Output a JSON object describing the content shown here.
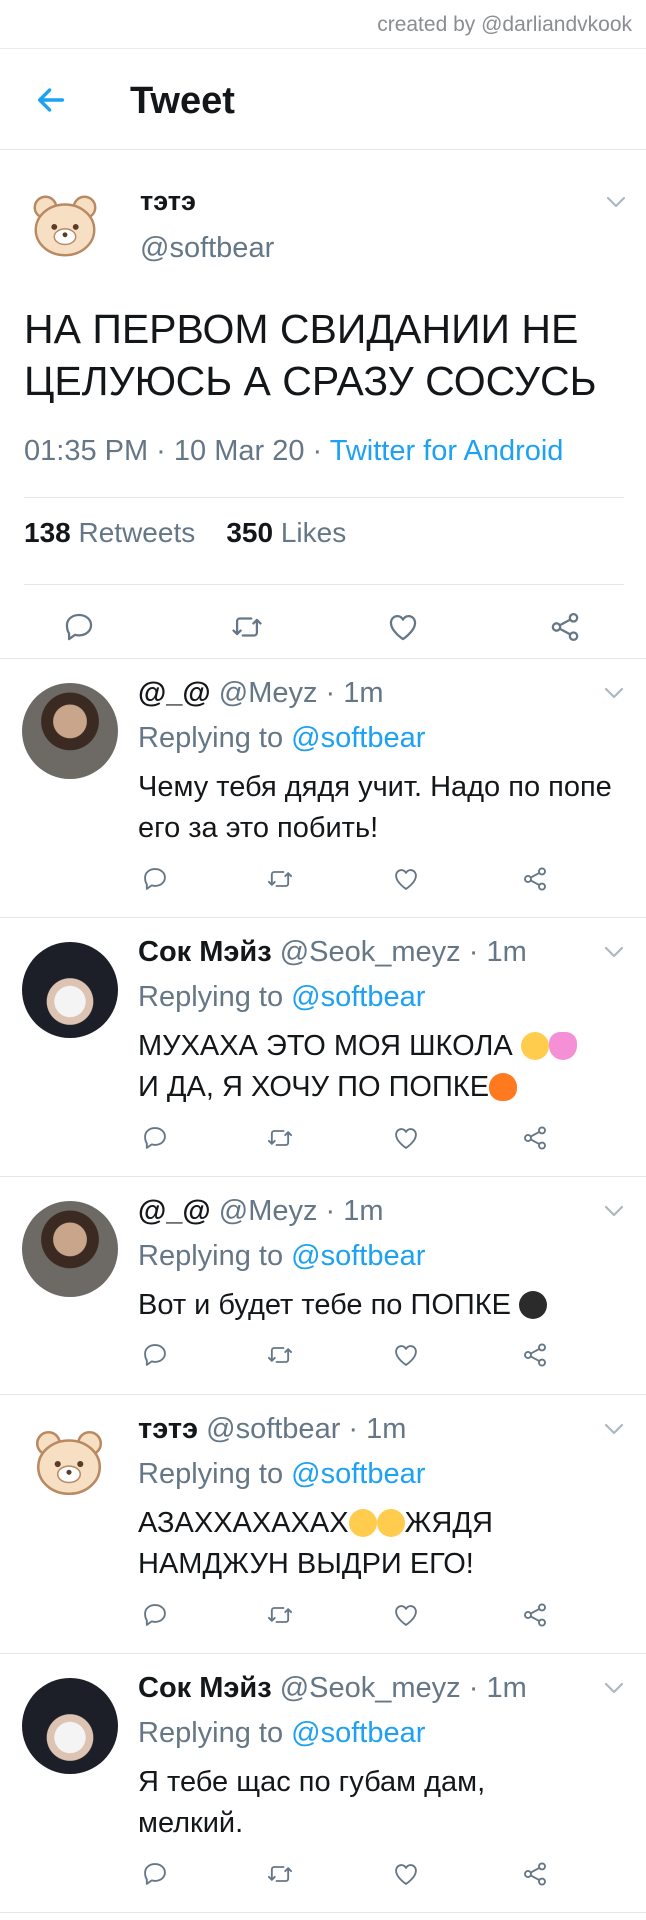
{
  "credit": "created by @darliandvkook",
  "header": {
    "title": "Tweet"
  },
  "main": {
    "name": "тэтэ",
    "handle": "@softbear",
    "text": "НА ПЕРВОМ СВИДАНИИ НЕ ЦЕЛУЮСЬ А СРАЗУ СОСУСЬ",
    "time": "01:35 PM · 10 Mar 20 · ",
    "source": "Twitter for Android",
    "retweets_count": "138",
    "retweets_label": "Retweets",
    "likes_count": "350",
    "likes_label": "Likes"
  },
  "replies": [
    {
      "name": "@_@",
      "handle": "@Meyz · 1m",
      "replying": "Replying to ",
      "to": "@softbear",
      "text": "Чему тебя дядя учит. Надо по попе его за это побить!"
    },
    {
      "name": "Сок Мэйз",
      "handle": "@Seok_meyz · 1m",
      "replying": "Replying to ",
      "to": "@softbear",
      "text1": "МУХАХА ЭТО МОЯ ШКОЛА",
      "text2": "И ДА, Я ХОЧУ ПО ПОПКЕ"
    },
    {
      "name": "@_@",
      "handle": "@Meyz · 1m",
      "replying": "Replying to ",
      "to": "@softbear",
      "text": "Вот и будет тебе по ПОПКЕ"
    },
    {
      "name": "тэтэ",
      "handle": "@softbear · 1m",
      "replying": "Replying to ",
      "to": "@softbear",
      "text1": "АЗАХХАХАХАХ",
      "text1b": "ЖЯДЯ",
      "text2": "НАМДЖУН ВЫДРИ ЕГО!"
    },
    {
      "name": "Сок Мэйз",
      "handle": "@Seok_meyz · 1m",
      "replying": "Replying to ",
      "to": "@softbear",
      "text": "Я тебе щас по губам дам, мелкий."
    }
  ],
  "colors": {
    "accent": "#1da1f2",
    "muted": "#657786",
    "text": "#14171a",
    "border": "#e1e8ed"
  },
  "icons": [
    "back-arrow-icon",
    "chevron-down-icon",
    "reply-icon",
    "retweet-icon",
    "like-icon",
    "share-icon"
  ]
}
